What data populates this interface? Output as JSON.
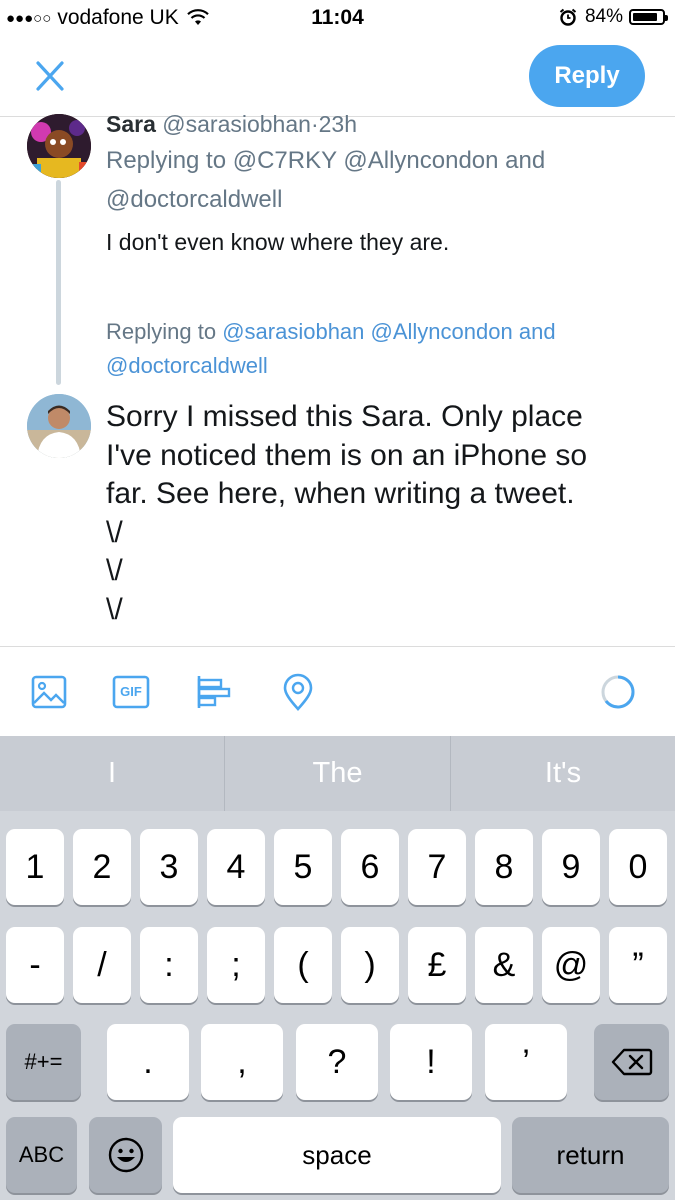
{
  "status_bar": {
    "carrier": "vodafone UK",
    "time": "11:04",
    "battery": "84%",
    "battery_level": 0.84
  },
  "header": {
    "reply_label": "Reply"
  },
  "parent_tweet": {
    "name": "Sara",
    "handle": "@sarasiobhan",
    "separator": "·",
    "age": "23h",
    "replying_line1": "Replying to @C7RKY @Allyncondon and",
    "replying_line2": "@doctorcaldwell",
    "text": "I don't even know where they are."
  },
  "composer": {
    "replying_prefix": "Replying to",
    "replying_mentions1": "@sarasiobhan @Allyncondon",
    "replying_and": "and",
    "replying_line2": "@doctorcaldwell",
    "text_lines": [
      "Sorry I missed this Sara. Only place",
      "I've noticed them is on an iPhone so",
      "far. See here, when writing a tweet.",
      "\\/",
      "\\/",
      "\\/"
    ]
  },
  "toolbar": {
    "icons": [
      "image-icon",
      "gif-icon",
      "poll-icon",
      "location-icon"
    ],
    "gif_label": "GIF"
  },
  "suggestions": [
    "I",
    "The",
    "It's"
  ],
  "keyboard": {
    "row1": [
      "1",
      "2",
      "3",
      "4",
      "5",
      "6",
      "7",
      "8",
      "9",
      "0"
    ],
    "row2": [
      "-",
      "/",
      ":",
      ";",
      "(",
      ")",
      "£",
      "&",
      "@",
      "”"
    ],
    "row3": [
      ".",
      ",",
      "?",
      "!",
      "’"
    ],
    "symbols_key": "#+=",
    "abc_key": "ABC",
    "space_key": "space",
    "return_key": "return"
  },
  "colors": {
    "accent": "#4ba6ef",
    "link": "#4b93d6",
    "muted": "#657786"
  }
}
